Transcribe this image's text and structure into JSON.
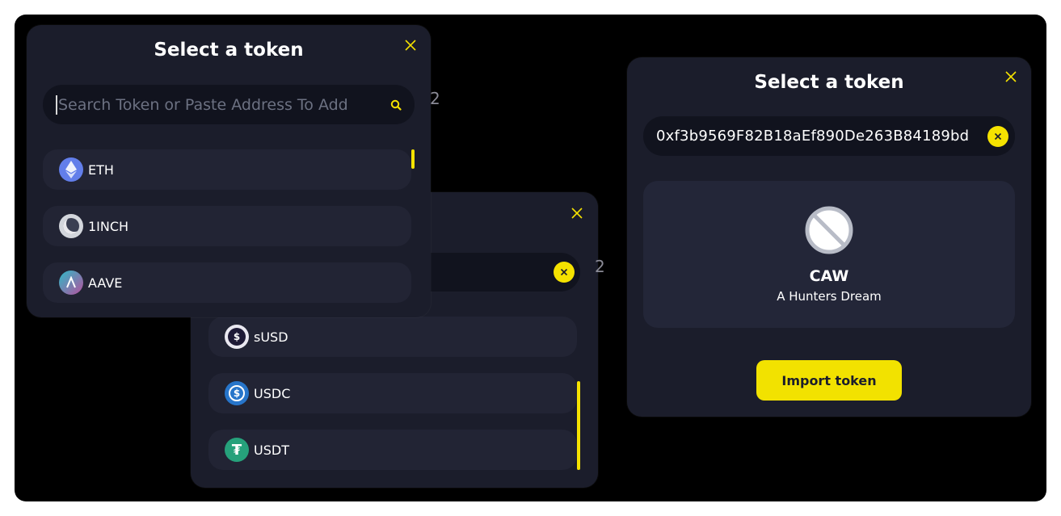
{
  "modal_a": {
    "title": "Select a token",
    "search_placeholder": "Search Token or Paste Address To Add",
    "tokens": [
      {
        "symbol": "ETH",
        "icon": "eth-icon"
      },
      {
        "symbol": "1INCH",
        "icon": "1inch-icon"
      },
      {
        "symbol": "AAVE",
        "icon": "aave-icon"
      }
    ]
  },
  "modal_b": {
    "title_fragment": "ken",
    "tokens": [
      {
        "symbol": "sUSD",
        "icon": "susd-icon"
      },
      {
        "symbol": "USDC",
        "icon": "usdc-icon"
      },
      {
        "symbol": "USDT",
        "icon": "usdt-icon"
      }
    ]
  },
  "modal_c": {
    "title": "Select a token",
    "search_value": "0xf3b9569F82B18aEf890De263B84189bd",
    "result": {
      "symbol": "CAW",
      "name": "A Hunters Dream",
      "icon": "no-logo-icon"
    },
    "import_label": "Import token"
  },
  "colors": {
    "modal_bg": "#1b1d2b",
    "row_bg": "#222434",
    "accent": "#f5e200",
    "canvas_bg": "#000000"
  }
}
